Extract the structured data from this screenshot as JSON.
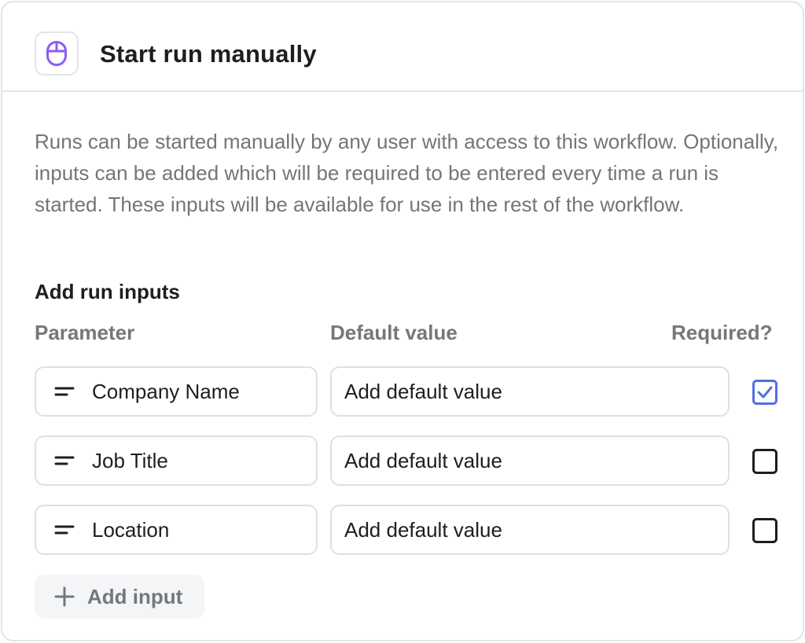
{
  "header": {
    "icon": "mouse-icon",
    "title": "Start run manually",
    "icon_color": "#8b5cf6"
  },
  "description": "Runs can be started manually by any user with access to this workflow. Optionally, inputs can be added which will be required to be entered every time a run is started. These inputs will be available for use in the rest of the workflow.",
  "inputs_section": {
    "title": "Add run inputs",
    "columns": {
      "parameter": "Parameter",
      "default": "Default value",
      "required": "Required?"
    },
    "rows": [
      {
        "parameter": "Company Name",
        "default_placeholder": "Add default value",
        "required": true
      },
      {
        "parameter": "Job Title",
        "default_placeholder": "Add default value",
        "required": false
      },
      {
        "parameter": "Location",
        "default_placeholder": "Add default value",
        "required": false
      }
    ],
    "add_button": "Add input"
  },
  "colors": {
    "accent": "#4f6fe8",
    "icon_purple": "#8b5cf6"
  }
}
